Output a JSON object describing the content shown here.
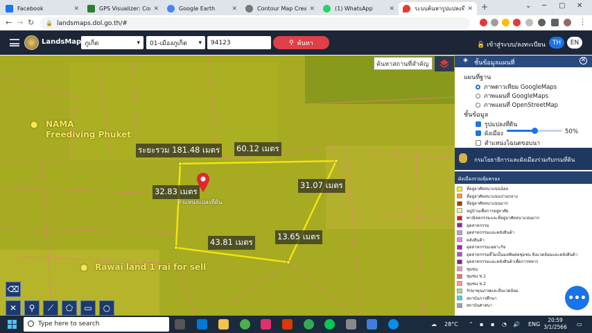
{
  "browser": {
    "tabs": [
      {
        "title": "Facebook",
        "color": "#1877f2"
      },
      {
        "title": "GPS Visualizer: Convert",
        "color": "#2e7d32"
      },
      {
        "title": "Google Earth",
        "color": "#4285f4"
      },
      {
        "title": "Contour Map Creator",
        "color": "#777777"
      },
      {
        "title": "(1) WhatsApp",
        "color": "#25d366"
      },
      {
        "title": "ระบบค้นหารูปแปลงที่ดิน",
        "color": "#e53935"
      }
    ],
    "new_tab": "+",
    "url": "landsmaps.dol.go.th/#"
  },
  "app": {
    "brand": "LandsMaps",
    "province": "ภูเก็ต",
    "district": "01-เมืองภูเก็ต",
    "parcel_no": "94123",
    "search_label": "ค้นหา",
    "login_label": "เข้าสู่ระบบ/ลงทะเบียน",
    "lang_th": "TH",
    "lang_en": "EN"
  },
  "map": {
    "search_place_placeholder": "ค้นหาสถานที่สำคัญ",
    "labels": {
      "total": "ระยะรวม 181.48 เมตร",
      "top": "60.12 เมตร",
      "left": "32.83 เมตร",
      "right": "31.07 เมตร",
      "bottom_right": "13.65 เมตร",
      "bottom": "43.81 เมตร"
    },
    "marker_label": "ตำแหน่งแปลงที่ดิน",
    "poi1_line1": "NAMA",
    "poi1_line2": "Freediving Phuket",
    "poi2": "Rawai land 1 rai for sell"
  },
  "panel": {
    "title": "ชั้นข้อมูลแผนที่",
    "basemap_heading": "แผนที่ฐาน",
    "basemaps": [
      "ภาพดาวเทียม GoogleMaps",
      "ภาพแผนที่ GoogleMaps",
      "ภาพแผนที่ OpenStreetMap"
    ],
    "layers_heading": "ชั้นข้อมูล",
    "layer_parcel": "รูปแปลงที่ดิน",
    "layer_city": "ผังเมือง",
    "layer_opacity": "50%",
    "layer_opacity_value": 0.5,
    "layer_location": "ตำแหน่งโฉนดขอบนา",
    "dept_name": "กรมโยธาธิการและผังเมืองร่วมกับกรมที่ดิน",
    "legend_heading": "ผังเมืองรวมคุ้มครอง",
    "legend": [
      {
        "label": "ที่อยู่อาศัยหนาแน่นน้อย",
        "color": "#f7f21a"
      },
      {
        "label": "ที่อยู่อาศัยหนาแน่นปานกลาง",
        "color": "#f59a23"
      },
      {
        "label": "ที่อยู่อาศัยหนาแน่นมาก",
        "color": "#8b4513"
      },
      {
        "label": "หมู่บ้านเพื่อการอยู่อาศัย",
        "color": "#f8f27c"
      },
      {
        "label": "พาณิชยกรรมและที่อยู่อาศัยหนาแน่นมาก",
        "color": "#d81b1b"
      },
      {
        "label": "อุตสาหกรรม",
        "color": "#8e24aa"
      },
      {
        "label": "อุตสาหกรรมและคลังสินค้า",
        "color": "#b39ddb"
      },
      {
        "label": "คลังสินค้า",
        "color": "#ce93d8"
      },
      {
        "label": "อุตสาหกรรมเฉพาะกิจ",
        "color": "#9c27b0"
      },
      {
        "label": "อุตสาหกรรมที่ไม่เป็นมลพิษต่อชุมชน สิ่งแวดล้อมและคลังสินค้า",
        "color": "#b44fc8"
      },
      {
        "label": "อุตสาหกรรมและคลังสินค้าเพื่อการทหาร",
        "color": "#7b1fa2"
      },
      {
        "label": "ชุมชน",
        "color": "#f48fb1"
      },
      {
        "label": "ชุมชน ช.1",
        "color": "#e57373"
      },
      {
        "label": "ชุมชน ช.2",
        "color": "#ef9a9a"
      },
      {
        "label": "รักษาคุณภาพและสิ่งแวดล้อม",
        "color": "#aed581"
      },
      {
        "label": "สถาบันการศึกษา",
        "color": "#4dd0e1"
      },
      {
        "label": "สถาบันศาสนา",
        "color": "#90a4ae"
      }
    ]
  },
  "taskbar": {
    "search_placeholder": "Type here to search",
    "weather": "28°C",
    "lang": "ENG",
    "time": "20:59",
    "date": "3/1/2566"
  }
}
